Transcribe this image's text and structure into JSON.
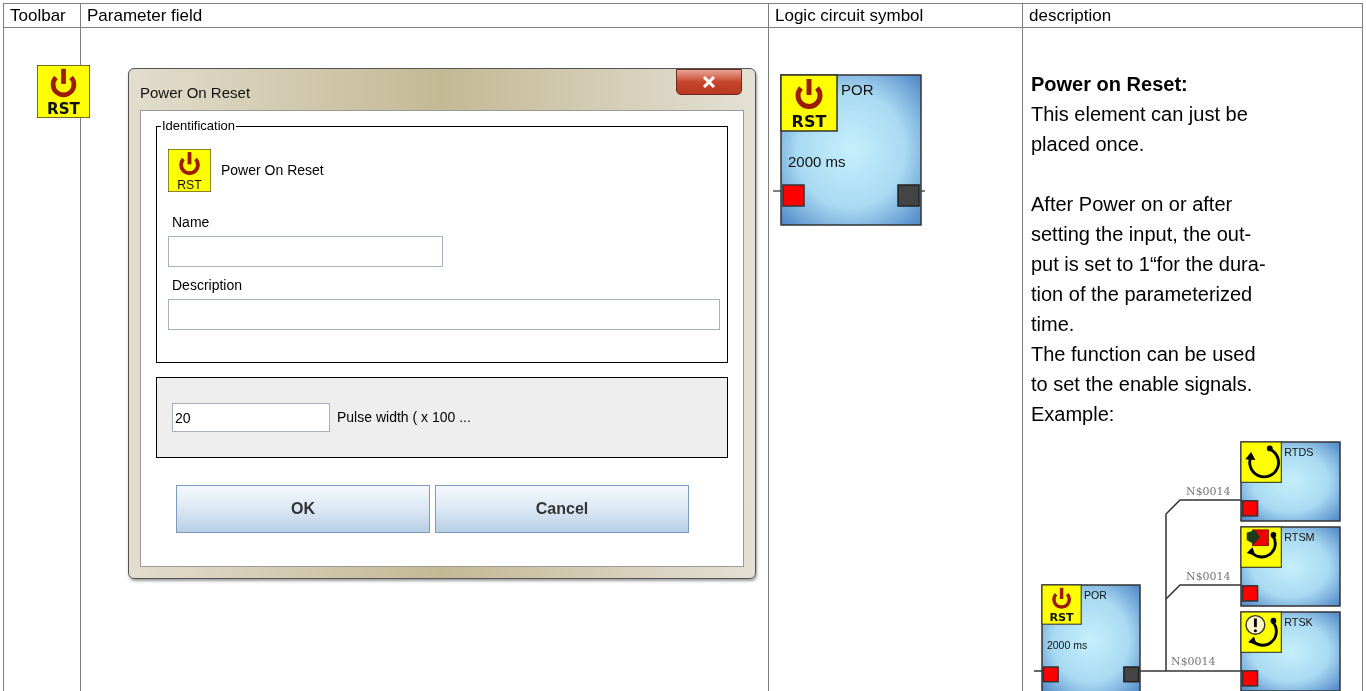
{
  "table": {
    "columns": [
      "Toolbar",
      "Parameter field",
      "Logic circuit symbol",
      "description"
    ]
  },
  "toolbar_icon": {
    "label": "RST"
  },
  "dialog": {
    "title": "Power On Reset",
    "group_title": "Identification",
    "element_icon_label": "RST",
    "element_name": "Power On Reset",
    "fields": [
      {
        "label": "Name"
      },
      {
        "label": "Description"
      }
    ],
    "pulse_width": {
      "value": "20",
      "label": "Pulse width ( x 100 ..."
    },
    "buttons": [
      "OK",
      "Cancel"
    ]
  },
  "symbol": {
    "kind": "power",
    "icon_label": "RST",
    "name": "POR",
    "time": "2000 ms"
  },
  "description": {
    "heading": "Power on Reset:",
    "paragraphs": [
      "This element can just be\nplaced once.",
      "After Power on or after\nsetting the input, the out-\nput is set to 1“for the dura-\ntion of the parameterized\ntime.\nThe function can be used\nto set the enable signals.\nExample:"
    ]
  },
  "example": {
    "blocks": [
      {
        "kind": "power",
        "icon_label": "RST",
        "name": "POR",
        "time": "2000 ms"
      },
      {
        "kind": "cycle",
        "name": "RTDS"
      },
      {
        "kind": "manual",
        "name": "RTSM"
      },
      {
        "kind": "alert",
        "name": "RTSK"
      }
    ],
    "nets": [
      "N$0014",
      "N$0014",
      "N$0014"
    ]
  }
}
